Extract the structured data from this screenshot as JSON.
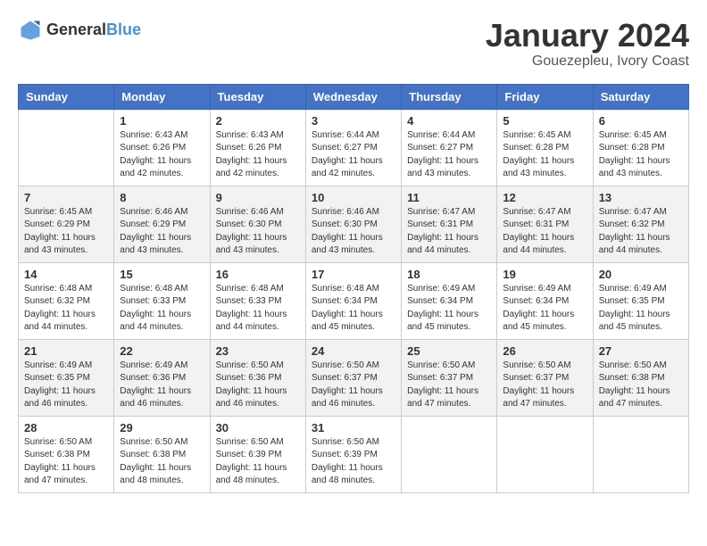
{
  "header": {
    "logo_general": "General",
    "logo_blue": "Blue",
    "month_title": "January 2024",
    "subtitle": "Gouezepleu, Ivory Coast"
  },
  "calendar": {
    "weekdays": [
      "Sunday",
      "Monday",
      "Tuesday",
      "Wednesday",
      "Thursday",
      "Friday",
      "Saturday"
    ],
    "weeks": [
      [
        {
          "day": "",
          "info": ""
        },
        {
          "day": "1",
          "info": "Sunrise: 6:43 AM\nSunset: 6:26 PM\nDaylight: 11 hours\nand 42 minutes."
        },
        {
          "day": "2",
          "info": "Sunrise: 6:43 AM\nSunset: 6:26 PM\nDaylight: 11 hours\nand 42 minutes."
        },
        {
          "day": "3",
          "info": "Sunrise: 6:44 AM\nSunset: 6:27 PM\nDaylight: 11 hours\nand 42 minutes."
        },
        {
          "day": "4",
          "info": "Sunrise: 6:44 AM\nSunset: 6:27 PM\nDaylight: 11 hours\nand 43 minutes."
        },
        {
          "day": "5",
          "info": "Sunrise: 6:45 AM\nSunset: 6:28 PM\nDaylight: 11 hours\nand 43 minutes."
        },
        {
          "day": "6",
          "info": "Sunrise: 6:45 AM\nSunset: 6:28 PM\nDaylight: 11 hours\nand 43 minutes."
        }
      ],
      [
        {
          "day": "7",
          "info": "Sunrise: 6:45 AM\nSunset: 6:29 PM\nDaylight: 11 hours\nand 43 minutes."
        },
        {
          "day": "8",
          "info": "Sunrise: 6:46 AM\nSunset: 6:29 PM\nDaylight: 11 hours\nand 43 minutes."
        },
        {
          "day": "9",
          "info": "Sunrise: 6:46 AM\nSunset: 6:30 PM\nDaylight: 11 hours\nand 43 minutes."
        },
        {
          "day": "10",
          "info": "Sunrise: 6:46 AM\nSunset: 6:30 PM\nDaylight: 11 hours\nand 43 minutes."
        },
        {
          "day": "11",
          "info": "Sunrise: 6:47 AM\nSunset: 6:31 PM\nDaylight: 11 hours\nand 44 minutes."
        },
        {
          "day": "12",
          "info": "Sunrise: 6:47 AM\nSunset: 6:31 PM\nDaylight: 11 hours\nand 44 minutes."
        },
        {
          "day": "13",
          "info": "Sunrise: 6:47 AM\nSunset: 6:32 PM\nDaylight: 11 hours\nand 44 minutes."
        }
      ],
      [
        {
          "day": "14",
          "info": "Sunrise: 6:48 AM\nSunset: 6:32 PM\nDaylight: 11 hours\nand 44 minutes."
        },
        {
          "day": "15",
          "info": "Sunrise: 6:48 AM\nSunset: 6:33 PM\nDaylight: 11 hours\nand 44 minutes."
        },
        {
          "day": "16",
          "info": "Sunrise: 6:48 AM\nSunset: 6:33 PM\nDaylight: 11 hours\nand 44 minutes."
        },
        {
          "day": "17",
          "info": "Sunrise: 6:48 AM\nSunset: 6:34 PM\nDaylight: 11 hours\nand 45 minutes."
        },
        {
          "day": "18",
          "info": "Sunrise: 6:49 AM\nSunset: 6:34 PM\nDaylight: 11 hours\nand 45 minutes."
        },
        {
          "day": "19",
          "info": "Sunrise: 6:49 AM\nSunset: 6:34 PM\nDaylight: 11 hours\nand 45 minutes."
        },
        {
          "day": "20",
          "info": "Sunrise: 6:49 AM\nSunset: 6:35 PM\nDaylight: 11 hours\nand 45 minutes."
        }
      ],
      [
        {
          "day": "21",
          "info": "Sunrise: 6:49 AM\nSunset: 6:35 PM\nDaylight: 11 hours\nand 46 minutes."
        },
        {
          "day": "22",
          "info": "Sunrise: 6:49 AM\nSunset: 6:36 PM\nDaylight: 11 hours\nand 46 minutes."
        },
        {
          "day": "23",
          "info": "Sunrise: 6:50 AM\nSunset: 6:36 PM\nDaylight: 11 hours\nand 46 minutes."
        },
        {
          "day": "24",
          "info": "Sunrise: 6:50 AM\nSunset: 6:37 PM\nDaylight: 11 hours\nand 46 minutes."
        },
        {
          "day": "25",
          "info": "Sunrise: 6:50 AM\nSunset: 6:37 PM\nDaylight: 11 hours\nand 47 minutes."
        },
        {
          "day": "26",
          "info": "Sunrise: 6:50 AM\nSunset: 6:37 PM\nDaylight: 11 hours\nand 47 minutes."
        },
        {
          "day": "27",
          "info": "Sunrise: 6:50 AM\nSunset: 6:38 PM\nDaylight: 11 hours\nand 47 minutes."
        }
      ],
      [
        {
          "day": "28",
          "info": "Sunrise: 6:50 AM\nSunset: 6:38 PM\nDaylight: 11 hours\nand 47 minutes."
        },
        {
          "day": "29",
          "info": "Sunrise: 6:50 AM\nSunset: 6:38 PM\nDaylight: 11 hours\nand 48 minutes."
        },
        {
          "day": "30",
          "info": "Sunrise: 6:50 AM\nSunset: 6:39 PM\nDaylight: 11 hours\nand 48 minutes."
        },
        {
          "day": "31",
          "info": "Sunrise: 6:50 AM\nSunset: 6:39 PM\nDaylight: 11 hours\nand 48 minutes."
        },
        {
          "day": "",
          "info": ""
        },
        {
          "day": "",
          "info": ""
        },
        {
          "day": "",
          "info": ""
        }
      ]
    ]
  }
}
